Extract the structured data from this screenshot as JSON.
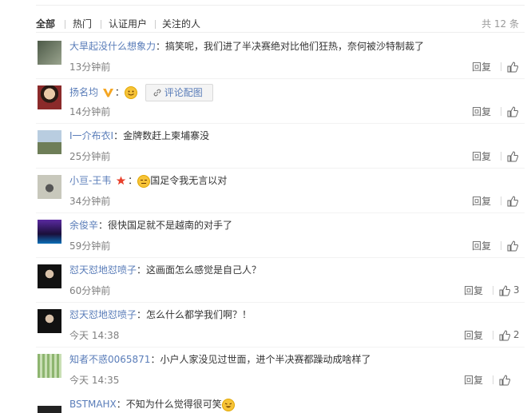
{
  "tabs": {
    "all": "全部",
    "hot": "热门",
    "verified": "认证用户",
    "following": "关注的人"
  },
  "total": "共 12 条",
  "reply_label": "回复",
  "comment_pic_label": "评论配图",
  "comments": [
    {
      "user": "大旱起没什么想象力",
      "text": "搞笑呢，我们进了半决赛绝对比他们狂热，奈何被沙特制裁了",
      "time": "13分钟前",
      "likes": "",
      "avatar_color": "#6e7a66"
    },
    {
      "user": "扬名均",
      "text": "",
      "time": "14分钟前",
      "likes": "",
      "avatar_color": "#8b2a2a",
      "vip": true,
      "has_smiley": true,
      "has_pic": true
    },
    {
      "user": "I一介布衣I",
      "text": "金牌数赶上柬埔寨没",
      "time": "25分钟前",
      "likes": "",
      "avatar_color": "#8fa8c4"
    },
    {
      "user": "小亘-王韦",
      "text": "国足令我无言以对",
      "time": "34分钟前",
      "likes": "",
      "avatar_color": "#9a9a8a",
      "star": true,
      "has_smiley": true
    },
    {
      "user": "余俊辛",
      "text": "很快国足就不是越南的对手了",
      "time": "59分钟前",
      "likes": "",
      "avatar_color": "#3b1f6e"
    },
    {
      "user": "怼天怼地怼喷子",
      "text": "这画面怎么感觉是自己人？",
      "time": "60分钟前",
      "likes": "3",
      "avatar_color": "#1d1d1d"
    },
    {
      "user": "怼天怼地怼喷子",
      "text": "怎么什么都学我们啊？！",
      "time": "今天 14:38",
      "likes": "2",
      "avatar_color": "#1d1d1d"
    },
    {
      "user": "知者不惑0065871",
      "text": "小户人家没见过世面，进个半决赛都躁动成啥样了",
      "time": "今天 14:35",
      "likes": "",
      "avatar_color": "#7ea36a"
    },
    {
      "user": "BSTMAHX",
      "text": "不知为什么觉得很可笑",
      "time": "",
      "likes": "",
      "avatar_color": "#222222",
      "has_smiley": true
    }
  ],
  "icons": {
    "like": "thumbs-up-icon",
    "vip": "vip-v-icon",
    "star": "star-icon",
    "smiley": "smiley-icon",
    "link": "link-icon"
  },
  "colors": {
    "username": "#5a7db9",
    "time": "#808080",
    "accent_vip": "#f5a623",
    "star": "#e8412c"
  }
}
